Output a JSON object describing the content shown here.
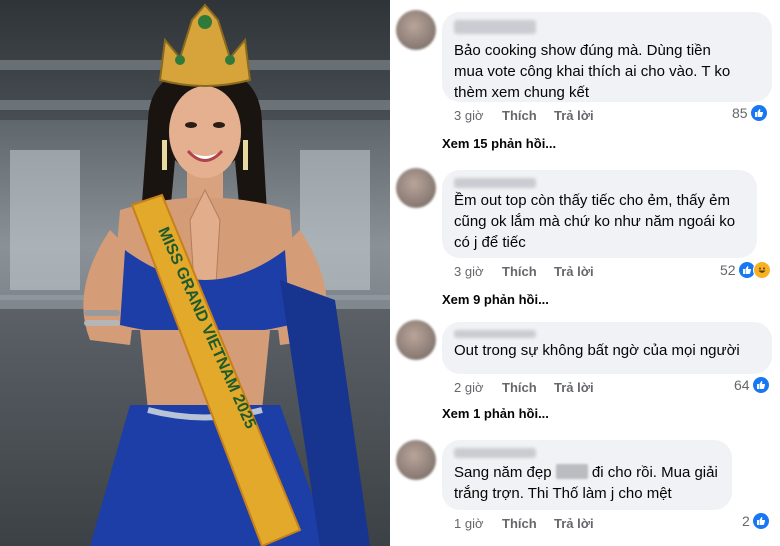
{
  "photo": {
    "sash_text": "MISS GRAND VIETNAM 2025",
    "description_icon": "woman-photo"
  },
  "comments": [
    {
      "text": "Bảo cooking show đúng mà. Dùng tiền\nmua vote công khai thích ai cho vào. T ko\nthèm xem chung kết",
      "time": "3 giờ",
      "like_label": "Thích",
      "reply_label": "Trả lời",
      "reaction_count": "85",
      "reactions": [
        "like-icon"
      ],
      "more_replies": "Xem 15 phản hồi..."
    },
    {
      "text": "Ềm out top còn thấy tiếc cho ẻm, thấy ẻm\ncũng ok lắm mà chứ ko như năm ngoái ko\ncó j để tiếc",
      "time": "3 giờ",
      "like_label": "Thích",
      "reply_label": "Trả lời",
      "reaction_count": "52",
      "reactions": [
        "like-icon",
        "haha-icon"
      ],
      "more_replies": "Xem 9 phản hồi..."
    },
    {
      "text": "Out trong sự không bất ngờ của mọi người",
      "time": "2 giờ",
      "like_label": "Thích",
      "reply_label": "Trả lời",
      "reaction_count": "64",
      "reactions": [
        "like-icon"
      ],
      "more_replies": "Xem 1 phản hồi..."
    },
    {
      "text_before": "Sang năm đẹp",
      "text_after": "đi cho rồi. Mua giải",
      "text_line2": "trắng trợn. Thi Thố làm j cho mệt",
      "time": "1 giờ",
      "like_label": "Thích",
      "reply_label": "Trả lời",
      "reaction_count": "2",
      "reactions": [
        "like-icon"
      ]
    }
  ],
  "colors": {
    "bubble": "#f0f2f5",
    "meta": "#65676b",
    "like_blue": "#1877f2",
    "sash_gold": "#e2a92a",
    "dress_blue": "#1c3ea6"
  }
}
